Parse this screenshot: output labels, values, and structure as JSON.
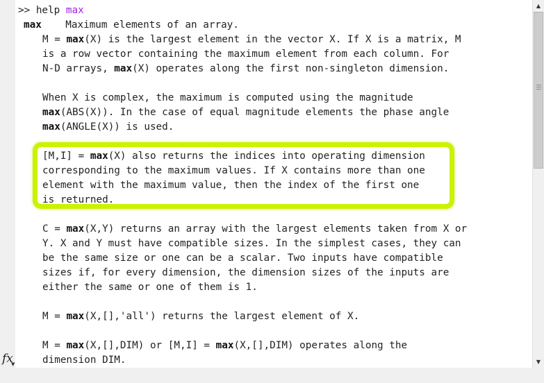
{
  "command": {
    "prompt": ">> ",
    "cmd": "help ",
    "arg": "max"
  },
  "help": {
    "title_kw": "max",
    "title_desc": "    Maximum elements of an array.",
    "p1": {
      "l1_a": "M = ",
      "l1_kw": "max",
      "l1_b": "(X) is the largest element in the vector X. If X is a matrix, M",
      "l2": "is a row vector containing the maximum element from each column. For",
      "l3_a": "N-D arrays, ",
      "l3_kw": "max",
      "l3_b": "(X) operates along the first non-singleton dimension."
    },
    "p2": {
      "l1": "When X is complex, the maximum is computed using the magnitude",
      "l2_kw": "max",
      "l2_b": "(ABS(X)). In the case of equal magnitude elements the phase angle",
      "l3_kw": "max",
      "l3_b": "(ANGLE(X)) is used."
    },
    "p3": {
      "l1_a": "[M,I] = ",
      "l1_kw": "max",
      "l1_b": "(X) also returns the indices into operating dimension",
      "l2": "corresponding to the maximum values. If X contains more than one",
      "l3": "element with the maximum value, then the index of the first one",
      "l4": "is returned."
    },
    "p4": {
      "l1_a": "C = ",
      "l1_kw": "max",
      "l1_b": "(X,Y) returns an array with the largest elements taken from X or",
      "l2": "Y. X and Y must have compatible sizes. In the simplest cases, they can",
      "l3": "be the same size or one can be a scalar. Two inputs have compatible",
      "l4": "sizes if, for every dimension, the dimension sizes of the inputs are",
      "l5": "either the same or one of them is 1."
    },
    "p5": {
      "l1_a": "M = ",
      "l1_kw": "max",
      "l1_b": "(X,[],'all') returns the largest element of X."
    },
    "p6": {
      "l1_a": "M = ",
      "l1_kw": "max",
      "l1_b": "(X,[],DIM) or [M,I] = ",
      "l1_kw2": "max",
      "l1_c": "(X,[],DIM) operates along the",
      "l2": "dimension DIM."
    }
  },
  "fx_label": "fx",
  "colors": {
    "highlight": "#ccf200",
    "argument": "#a020f0",
    "text": "#222222",
    "background": "#ffffff"
  },
  "icons": {
    "menu": "chevron-down-circle-icon",
    "scroll_up": "triangle-up-icon",
    "scroll_down": "triangle-down-icon",
    "fx": "function-browser-icon"
  }
}
